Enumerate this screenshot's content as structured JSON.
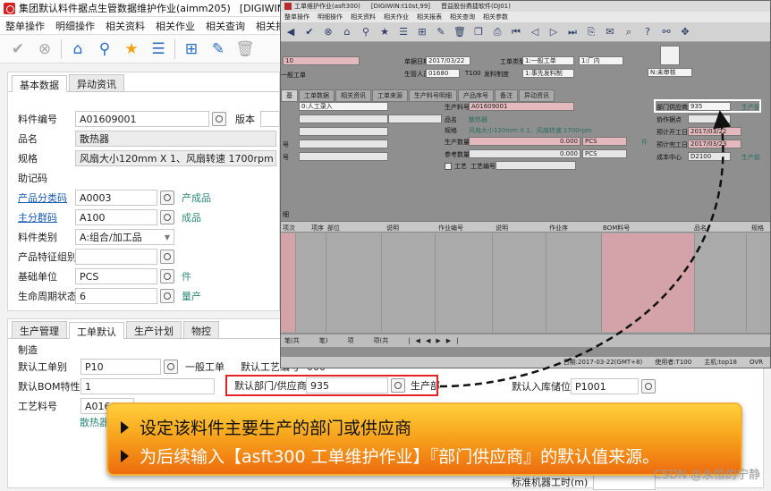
{
  "main": {
    "title": "集团默认料件据点生管数据维护作业(aimm205)",
    "title_env": "[DIGIWIN:t10",
    "menu": [
      "整单操作",
      "明细操作",
      "相关资料",
      "相关作业",
      "相关查询",
      "相关报"
    ],
    "toolbar_icons": [
      "check-icon",
      "cancel-icon",
      "home-icon",
      "location-icon",
      "star-icon",
      "list-icon",
      "add-icon",
      "edit-icon",
      "delete-icon"
    ],
    "top_tabs": [
      "基本数据",
      "异动资讯"
    ],
    "fields": {
      "item_no_label": "料件编号",
      "item_no": "A01609001",
      "version_label": "版本",
      "name_label": "品名",
      "name": "散热器",
      "spec_label": "规格",
      "spec": "风扇大小120mm X 1、风扇转速 1700rpm",
      "mnemonic_label": "助记码",
      "mnemonic": "",
      "product_class_label": "产品分类码",
      "product_class": "A0003",
      "product_class_desc": "产成品",
      "main_group_label": "主分群码",
      "main_group": "A100",
      "main_group_desc": "成品",
      "item_type_label": "料件类别",
      "item_type": "A:组合/加工品",
      "feature_group_label": "产品特征组别",
      "feature_group": "",
      "base_unit_label": "基础单位",
      "base_unit": "PCS",
      "base_unit_desc": "件",
      "lifecycle_label": "生命周期状态",
      "lifecycle": "6",
      "lifecycle_desc": "量产"
    },
    "bottom_tabs": [
      "生产管理",
      "工单默认",
      "生产计划",
      "物控"
    ],
    "section_label": "制造",
    "bottom_fields": {
      "wo_type_label": "默认工单别",
      "wo_type": "P10",
      "wo_type_desc": "一般工单",
      "process_label": "默认工艺编号",
      "process": "000",
      "bom_label": "默认BOM特性",
      "bom": "1",
      "dept_label": "默认部门/供应商",
      "dept": "935",
      "dept_desc": "生产部",
      "route_label": "工艺料号",
      "route": "A01600",
      "route_desc": "散热器",
      "wh_label": "默认入库储位",
      "wh": "P1001",
      "std_hours_label": "标准机器工时(m)"
    }
  },
  "overlay": {
    "title": "工单维护作业(asft300)",
    "title_env": "[DIGIWIN:t10st,99]",
    "title_company": "晋益股份鼎捷软件(DJ01)",
    "menu": [
      "整单操作",
      "明细操作",
      "相关资料",
      "相关作业",
      "相关报表",
      "相关查询",
      "相关参数"
    ],
    "header": {
      "wo_prefix": "10",
      "doc_date_label": "单据日期",
      "doc_date": "2017/03/22",
      "wo_type_label": "工单类型",
      "wo_type": "1:一般工单",
      "plant_value": "1:厂内",
      "wo_kind": "一般工单",
      "producer_label": "生管人员",
      "producer": "01680",
      "producer_code": "T100",
      "issue_rule_label": "发料制度",
      "issue_rule": "1:事先发料制",
      "status_value": "N:未审核"
    },
    "tabs": [
      "基",
      "工单数据",
      "相关资讯",
      "工单来源",
      "生产料号明细",
      "产品序号",
      "备注",
      "异动资讯"
    ],
    "left_value": "0:人工录入",
    "mid": {
      "item_label": "生产料号",
      "item": "A01609001",
      "name_label": "品名",
      "name": "散热器",
      "spec_label": "规格",
      "spec": "风扇大小120mm X 1、风扇转速 1700rpm",
      "qty_label": "生产数量",
      "qty": "0.000",
      "qty_unit": "PCS",
      "qty_unit_desc": "件",
      "ref_qty_label": "参考数量",
      "ref_qty": "0.000",
      "ref_unit": "PCS",
      "process_chk_label": "工艺",
      "process_no_label": "工艺编号"
    },
    "left_stub_labels": [
      "号",
      "号"
    ],
    "right": {
      "dept_label": "部门供应商",
      "dept": "935",
      "dept_desc": "生产部",
      "coop_label": "协作据点",
      "plan_start_label": "预计开工日",
      "plan_start": "2017/03/22",
      "plan_end_label": "预计完工日",
      "plan_end": "2017/03/23",
      "cost_center_label": "成本中心",
      "cost_center": "D2100",
      "cost_center_desc": "生产部"
    },
    "grid_label": "细",
    "grid_headers": [
      "项次",
      "项序",
      "部位",
      "说明",
      "作业编号",
      "说明",
      "作业序",
      "BOM料号",
      "品名",
      "规格"
    ],
    "nav": [
      "笔(共",
      "笔)",
      "项",
      "项(共"
    ],
    "status": [
      "日期:2017-03-22(GMT+8)",
      "使用者:T100",
      "主机:top18",
      "OVR"
    ],
    "side_value": "1000"
  },
  "banner": {
    "line1": "设定该料件主要生产的部门或供应商",
    "line2_prefix": "为后续输入【asft300 工单维护作业】『部门供应商』的默认值来源。"
  },
  "watermark": "CSDN @永恒的宁静",
  "colors": {
    "highlight_red": "#e32424",
    "link_blue": "#1a5db6",
    "desc_teal": "#2c8a7a",
    "banner_top": "#ffcf3b",
    "banner_bottom": "#ee6c0e"
  }
}
